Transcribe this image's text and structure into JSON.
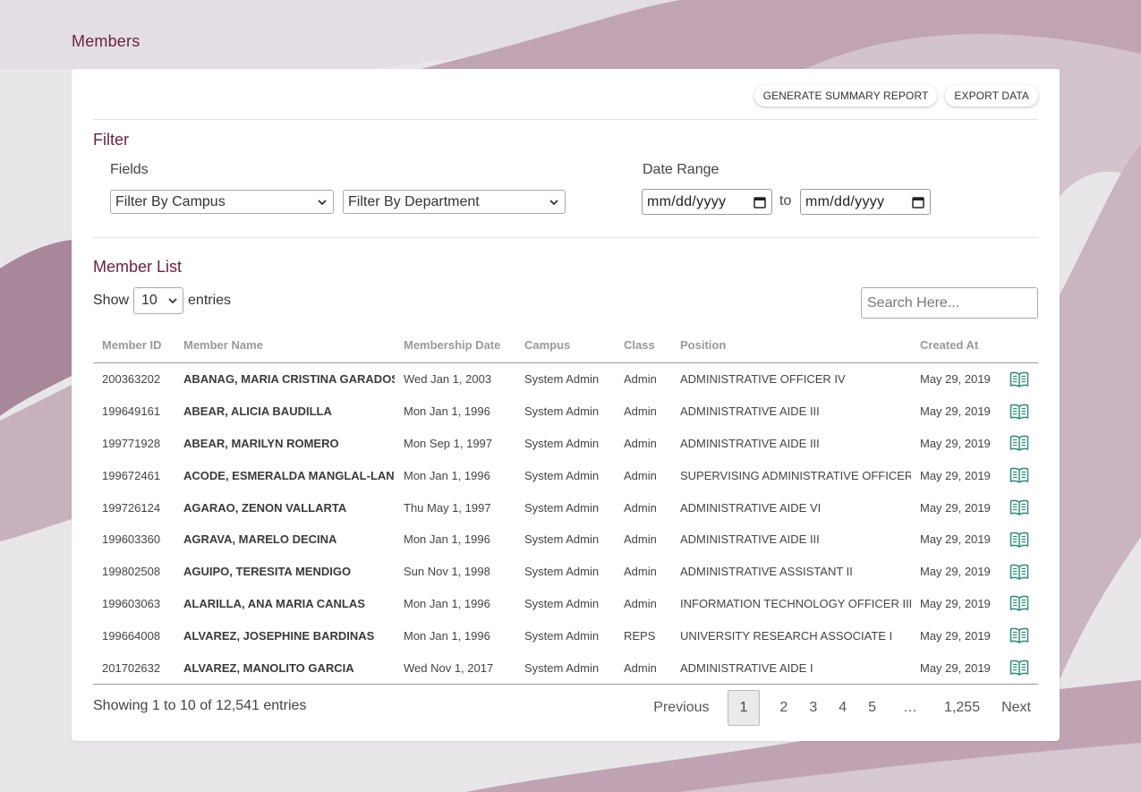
{
  "page": {
    "title": "Members"
  },
  "toolbar": {
    "summary_label": "GENERATE SUMMARY REPORT",
    "export_label": "EXPORT DATA"
  },
  "filter": {
    "title": "Filter",
    "fields_label": "Fields",
    "campus": "Filter By Campus",
    "department": "Filter By Department",
    "date_range_label": "Date Range",
    "date_from": "mm/dd/yyyy",
    "to_label": "to",
    "date_to": "mm/dd/yyyy"
  },
  "list": {
    "title": "Member List",
    "show_label": "Show",
    "entries_value": "10",
    "entries_label": "entries",
    "search_placeholder": "Search Here...",
    "columns": [
      "Member ID",
      "Member Name",
      "Membership Date",
      "Campus",
      "Class",
      "Position",
      "Created At",
      ""
    ],
    "rows": [
      {
        "id": "200363202",
        "name": "ABANAG, MARIA CRISTINA GARADOS",
        "date": "Wed Jan 1, 2003",
        "campus": "System Admin",
        "class": "Admin",
        "position": "ADMINISTRATIVE OFFICER IV",
        "created": "May 29, 2019"
      },
      {
        "id": "199649161",
        "name": "ABEAR, ALICIA BAUDILLA",
        "date": "Mon Jan 1, 1996",
        "campus": "System Admin",
        "class": "Admin",
        "position": "ADMINISTRATIVE AIDE III",
        "created": "May 29, 2019"
      },
      {
        "id": "199771928",
        "name": "ABEAR, MARILYN ROMERO",
        "date": "Mon Sep 1, 1997",
        "campus": "System Admin",
        "class": "Admin",
        "position": "ADMINISTRATIVE AIDE III",
        "created": "May 29, 2019"
      },
      {
        "id": "199672461",
        "name": "ACODE, ESMERALDA MANGLAL-LAN",
        "date": "Mon Jan 1, 1996",
        "campus": "System Admin",
        "class": "Admin",
        "position": "SUPERVISING ADMINISTRATIVE OFFICER",
        "created": "May 29, 2019"
      },
      {
        "id": "199726124",
        "name": "AGARAO, ZENON VALLARTA",
        "date": "Thu May 1, 1997",
        "campus": "System Admin",
        "class": "Admin",
        "position": "ADMINISTRATIVE AIDE VI",
        "created": "May 29, 2019"
      },
      {
        "id": "199603360",
        "name": "AGRAVA, MARELO DECINA",
        "date": "Mon Jan 1, 1996",
        "campus": "System Admin",
        "class": "Admin",
        "position": "ADMINISTRATIVE AIDE III",
        "created": "May 29, 2019"
      },
      {
        "id": "199802508",
        "name": "AGUIPO, TERESITA MENDIGO",
        "date": "Sun Nov 1, 1998",
        "campus": "System Admin",
        "class": "Admin",
        "position": "ADMINISTRATIVE ASSISTANT II",
        "created": "May 29, 2019"
      },
      {
        "id": "199603063",
        "name": "ALARILLA, ANA MARIA CANLAS",
        "date": "Mon Jan 1, 1996",
        "campus": "System Admin",
        "class": "Admin",
        "position": "INFORMATION TECHNOLOGY OFFICER III",
        "created": "May 29, 2019"
      },
      {
        "id": "199664008",
        "name": "ALVAREZ, JOSEPHINE BARDINAS",
        "date": "Mon Jan 1, 1996",
        "campus": "System Admin",
        "class": "REPS",
        "position": "UNIVERSITY RESEARCH ASSOCIATE I",
        "created": "May 29, 2019"
      },
      {
        "id": "201702632",
        "name": "ALVAREZ, MANOLITO GARCIA",
        "date": "Wed Nov 1, 2017",
        "campus": "System Admin",
        "class": "Admin",
        "position": "ADMINISTRATIVE AIDE I",
        "created": "May 29, 2019"
      }
    ],
    "row_icon": "book-open-icon",
    "showing": "Showing 1 to 10 of 12,541 entries"
  },
  "pagination": {
    "previous": "Previous",
    "pages": [
      "1",
      "2",
      "3",
      "4",
      "5",
      "…",
      "1,255"
    ],
    "active": "1",
    "next": "Next"
  },
  "colors": {
    "accent": "#6b2340",
    "icon": "#2e8b7a",
    "bg_wave_dark": "#b08ea0",
    "bg_wave_light": "#d4c2cc"
  }
}
